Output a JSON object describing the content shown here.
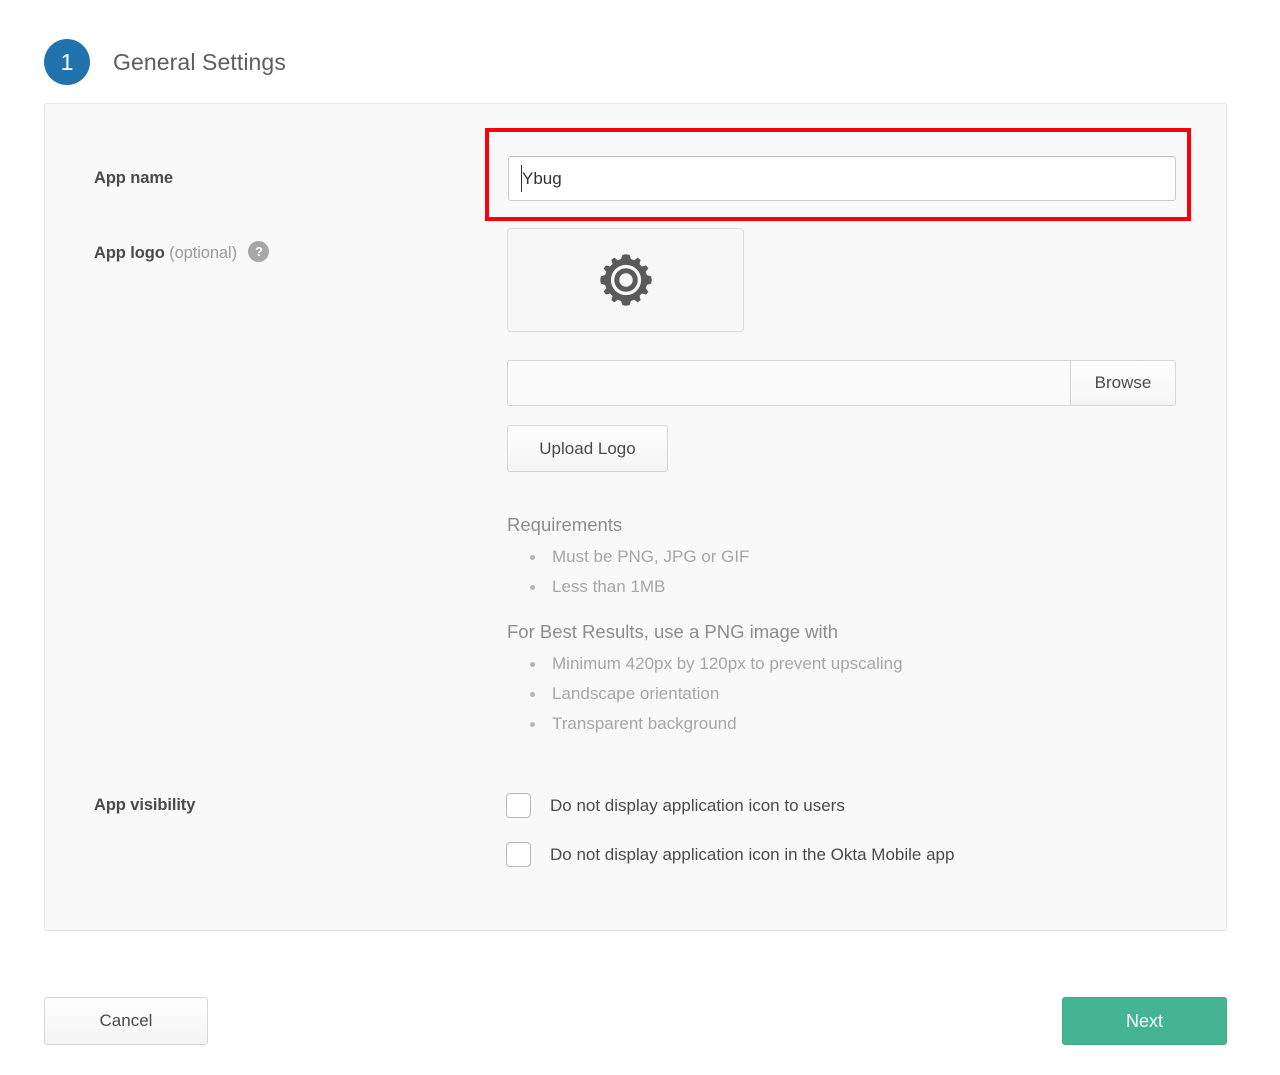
{
  "step": {
    "number": "1",
    "title": "General Settings",
    "accent_color": "#2073ac"
  },
  "form": {
    "app_name": {
      "label": "App name",
      "value": "Ybug",
      "placeholder": "",
      "highlighted": true,
      "highlight_color": "#fb0007"
    },
    "app_logo": {
      "label": "App logo",
      "optional_text": "(optional)",
      "help_icon": "question-mark-icon",
      "preview_icon": "gear-icon",
      "file_path_value": "",
      "file_path_placeholder": "",
      "browse_label": "Browse",
      "upload_label": "Upload Logo",
      "requirements": {
        "title": "Requirements",
        "items": [
          "Must be PNG, JPG or GIF",
          "Less than 1MB"
        ]
      },
      "best_results": {
        "title": "For Best Results, use a PNG image with",
        "items": [
          "Minimum 420px by 120px to prevent upscaling",
          "Landscape orientation",
          "Transparent background"
        ]
      }
    },
    "app_visibility": {
      "label": "App visibility",
      "checkboxes": [
        {
          "label": "Do not display application icon to users",
          "checked": false
        },
        {
          "label": "Do not display application icon in the Okta Mobile app",
          "checked": false
        }
      ]
    }
  },
  "footer": {
    "cancel_label": "Cancel",
    "next_label": "Next",
    "next_color": "#45b492"
  }
}
